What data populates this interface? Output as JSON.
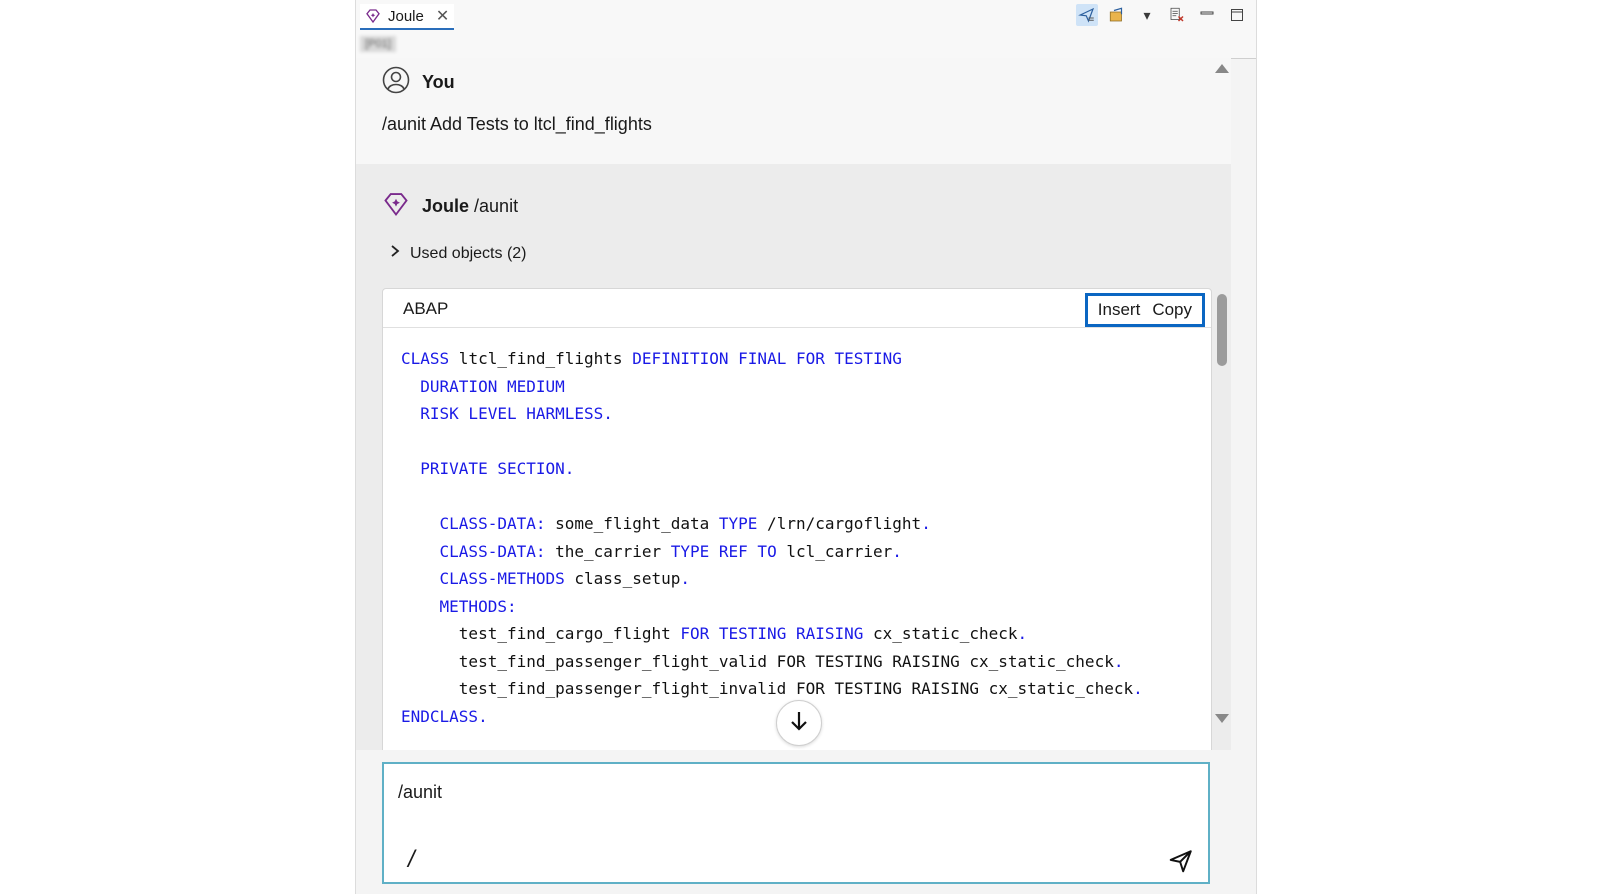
{
  "tab": {
    "title": "Joule"
  },
  "system_id": "[P01]",
  "conversation": {
    "user_message": {
      "sender": "You",
      "text": "/aunit Add Tests to ltcl_find_flights"
    },
    "assistant_message": {
      "sender": "Joule",
      "command": "/aunit",
      "used_objects_label": "Used objects (2)",
      "code_block": {
        "language": "ABAP",
        "insert_label": "Insert",
        "copy_label": "Copy"
      }
    }
  },
  "input": {
    "value": "/aunit",
    "slash_label": "/"
  },
  "colors": {
    "accent": "#0a66c2",
    "keyword": "#1a1ae6",
    "joule_purple": "#7a2a8c",
    "input_border": "#5fb0c6"
  }
}
